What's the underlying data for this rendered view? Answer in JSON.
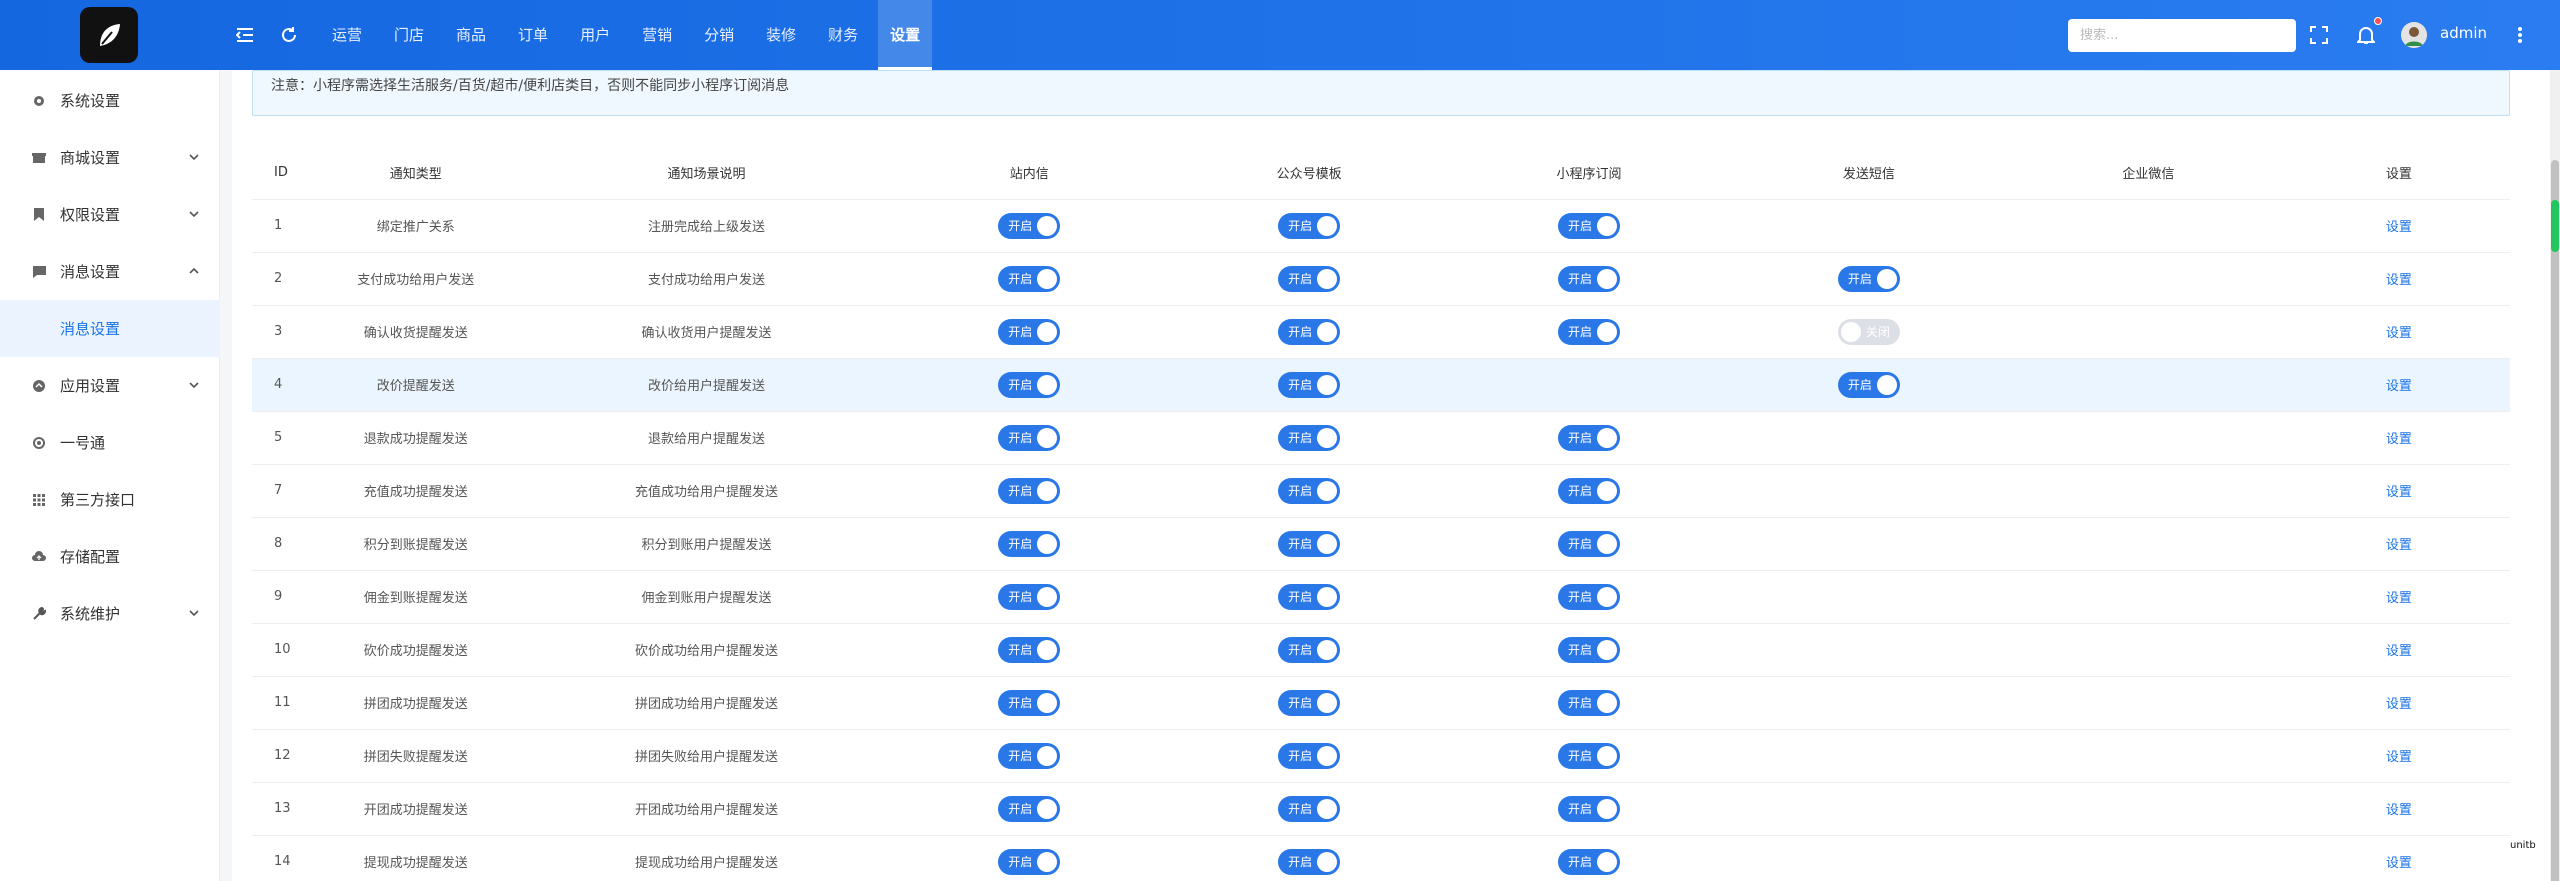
{
  "header": {
    "nav": [
      "运营",
      "门店",
      "商品",
      "订单",
      "用户",
      "营销",
      "分销",
      "装修",
      "财务",
      "设置"
    ],
    "active_nav": "设置",
    "search_placeholder": "搜索...",
    "user_name": "admin"
  },
  "sidebar": {
    "items": [
      {
        "label": "系统设置",
        "icon": "gear-icon",
        "chevron": false
      },
      {
        "label": "商城设置",
        "icon": "shop-icon",
        "chevron": true
      },
      {
        "label": "权限设置",
        "icon": "bookmark-icon",
        "chevron": true
      },
      {
        "label": "消息设置",
        "icon": "message-icon",
        "chevron": true,
        "expanded": true
      },
      {
        "label": "消息设置",
        "icon": "",
        "sub": true
      },
      {
        "label": "应用设置",
        "icon": "app-icon",
        "chevron": true
      },
      {
        "label": "一号通",
        "icon": "circle-icon",
        "chevron": false
      },
      {
        "label": "第三方接口",
        "icon": "grid-icon",
        "chevron": false
      },
      {
        "label": "存储配置",
        "icon": "cloud-icon",
        "chevron": false
      },
      {
        "label": "系统维护",
        "icon": "wrench-icon",
        "chevron": true
      }
    ]
  },
  "notice": "注意：小程序需选择生活服务/百货/超市/便利店类目，否则不能同步小程序订阅消息",
  "table": {
    "headers": [
      "ID",
      "通知类型",
      "通知场景说明",
      "站内信",
      "公众号模板",
      "小程序订阅",
      "发送短信",
      "企业微信",
      "设置"
    ],
    "on_label": "开启",
    "off_label": "关闭",
    "action_label": "设置",
    "rows": [
      {
        "id": "1",
        "type": "绑定推广关系",
        "desc": "注册完成给上级发送",
        "site": "on",
        "wechat": "on",
        "mini": "on",
        "sms": "",
        "hl": false
      },
      {
        "id": "2",
        "type": "支付成功给用户发送",
        "desc": "支付成功给用户发送",
        "site": "on",
        "wechat": "on",
        "mini": "on",
        "sms": "on",
        "hl": false
      },
      {
        "id": "3",
        "type": "确认收货提醒发送",
        "desc": "确认收货用户提醒发送",
        "site": "on",
        "wechat": "on",
        "mini": "on",
        "sms": "off",
        "hl": false
      },
      {
        "id": "4",
        "type": "改价提醒发送",
        "desc": "改价给用户提醒发送",
        "site": "on",
        "wechat": "on",
        "mini": "",
        "sms": "on",
        "hl": true
      },
      {
        "id": "5",
        "type": "退款成功提醒发送",
        "desc": "退款给用户提醒发送",
        "site": "on",
        "wechat": "on",
        "mini": "on",
        "sms": "",
        "hl": false
      },
      {
        "id": "7",
        "type": "充值成功提醒发送",
        "desc": "充值成功给用户提醒发送",
        "site": "on",
        "wechat": "on",
        "mini": "on",
        "sms": "",
        "hl": false
      },
      {
        "id": "8",
        "type": "积分到账提醒发送",
        "desc": "积分到账用户提醒发送",
        "site": "on",
        "wechat": "on",
        "mini": "on",
        "sms": "",
        "hl": false
      },
      {
        "id": "9",
        "type": "佣金到账提醒发送",
        "desc": "佣金到账用户提醒发送",
        "site": "on",
        "wechat": "on",
        "mini": "on",
        "sms": "",
        "hl": false
      },
      {
        "id": "10",
        "type": "砍价成功提醒发送",
        "desc": "砍价成功给用户提醒发送",
        "site": "on",
        "wechat": "on",
        "mini": "on",
        "sms": "",
        "hl": false
      },
      {
        "id": "11",
        "type": "拼团成功提醒发送",
        "desc": "拼团成功给用户提醒发送",
        "site": "on",
        "wechat": "on",
        "mini": "on",
        "sms": "",
        "hl": false
      },
      {
        "id": "12",
        "type": "拼团失败提醒发送",
        "desc": "拼团失败给用户提醒发送",
        "site": "on",
        "wechat": "on",
        "mini": "on",
        "sms": "",
        "hl": false
      },
      {
        "id": "13",
        "type": "开团成功提醒发送",
        "desc": "开团成功给用户提醒发送",
        "site": "on",
        "wechat": "on",
        "mini": "on",
        "sms": "",
        "hl": false
      },
      {
        "id": "14",
        "type": "提现成功提醒发送",
        "desc": "提现成功给用户提醒发送",
        "site": "on",
        "wechat": "on",
        "mini": "on",
        "sms": "",
        "hl": false
      }
    ]
  },
  "corner_tag": "unitb",
  "colors": {
    "header": "#1567e0",
    "toggle_on": "#2a78e8",
    "toggle_off": "#dcdfe6",
    "link": "#1a73e8"
  }
}
